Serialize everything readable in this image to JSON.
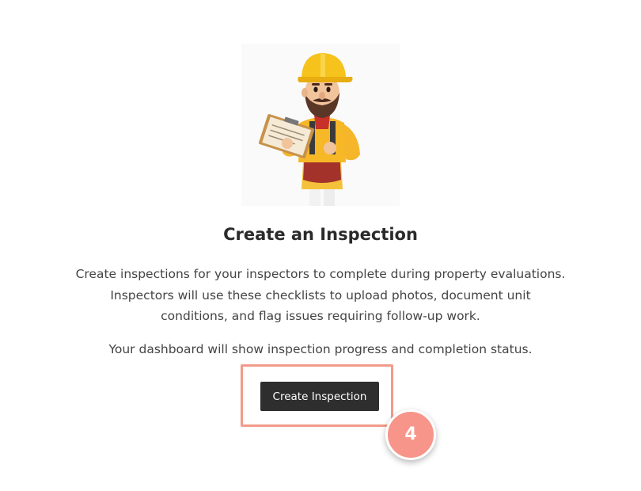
{
  "empty_state": {
    "illustration_icon": "inspector-with-clipboard-icon",
    "title": "Create an Inspection",
    "description": "Create inspections for your inspectors to complete during property evaluations. Inspectors will use these checklists to upload photos, document unit conditions, and flag issues requiring follow-up work.",
    "status_note": "Your dashboard will show inspection progress and completion status.",
    "button_label": "Create Inspection"
  },
  "tutorial": {
    "step_number": "4",
    "highlight_color": "#f29b8a",
    "badge_color": "#f7958a"
  },
  "colors": {
    "button_background": "#2e2e2e",
    "button_text": "#ffffff"
  }
}
